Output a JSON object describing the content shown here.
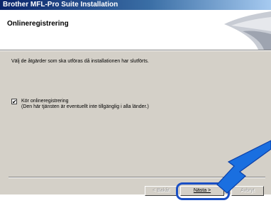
{
  "window": {
    "title": "Brother MFL-Pro Suite Installation"
  },
  "header": {
    "title": "Onlineregistrering"
  },
  "body": {
    "instruction": "Välj de åtgärder som ska utföras då installationen har slutförts.",
    "checkbox": {
      "checked": true,
      "label": "Kör onlineregistrering",
      "note": "(Den här tjänsten är eventuellt inte tillgänglig i alla länder.)"
    }
  },
  "buttons": {
    "back": "< Bakåt",
    "next": "Nästa >",
    "cancel": "Avbryt"
  },
  "colors": {
    "highlight": "#1a4fc4",
    "title_bar": "#0a246a",
    "dialog_bg": "#d4d0c8"
  },
  "icons": {
    "checkbox_mark": "check-icon",
    "pointer": "arrow-pointer-icon",
    "header_graphic": "wizard-banner-graphic"
  }
}
